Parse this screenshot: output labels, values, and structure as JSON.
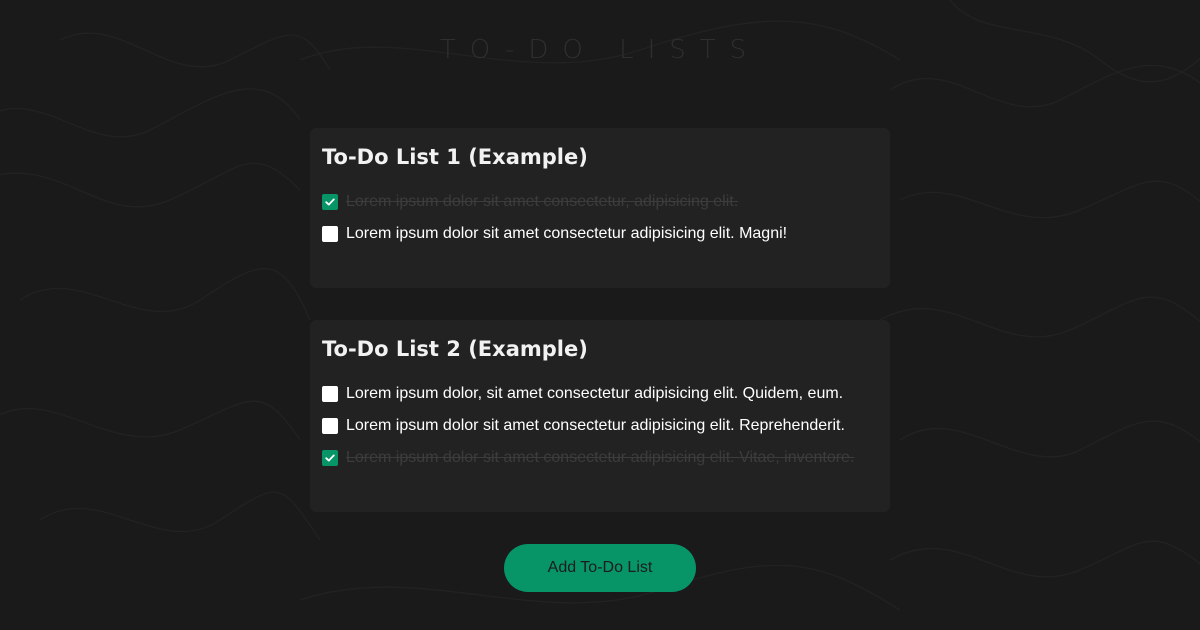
{
  "page": {
    "title": "TO-DO LISTS"
  },
  "lists": [
    {
      "title": "To-Do List 1 (Example)",
      "items": [
        {
          "text": "Lorem ipsum dolor sit amet consectetur, adipisicing elit.",
          "checked": true
        },
        {
          "text": "Lorem ipsum dolor sit amet consectetur adipisicing elit. Magni!",
          "checked": false
        }
      ]
    },
    {
      "title": "To-Do List 2 (Example)",
      "items": [
        {
          "text": "Lorem ipsum dolor, sit amet consectetur adipisicing elit. Quidem, eum.",
          "checked": false
        },
        {
          "text": "Lorem ipsum dolor sit amet consectetur adipisicing elit. Reprehenderit.",
          "checked": false
        },
        {
          "text": "Lorem ipsum dolor sit amet consectetur adipisicing elit. Vitae, inventore.",
          "checked": true
        }
      ]
    }
  ],
  "actions": {
    "add_list_label": "Add To-Do List"
  },
  "colors": {
    "background": "#1a1a1a",
    "card": "#222222",
    "accent": "#079467",
    "completed_text": "#3c3c3c"
  },
  "icons": {
    "check": "checkmark-icon"
  }
}
